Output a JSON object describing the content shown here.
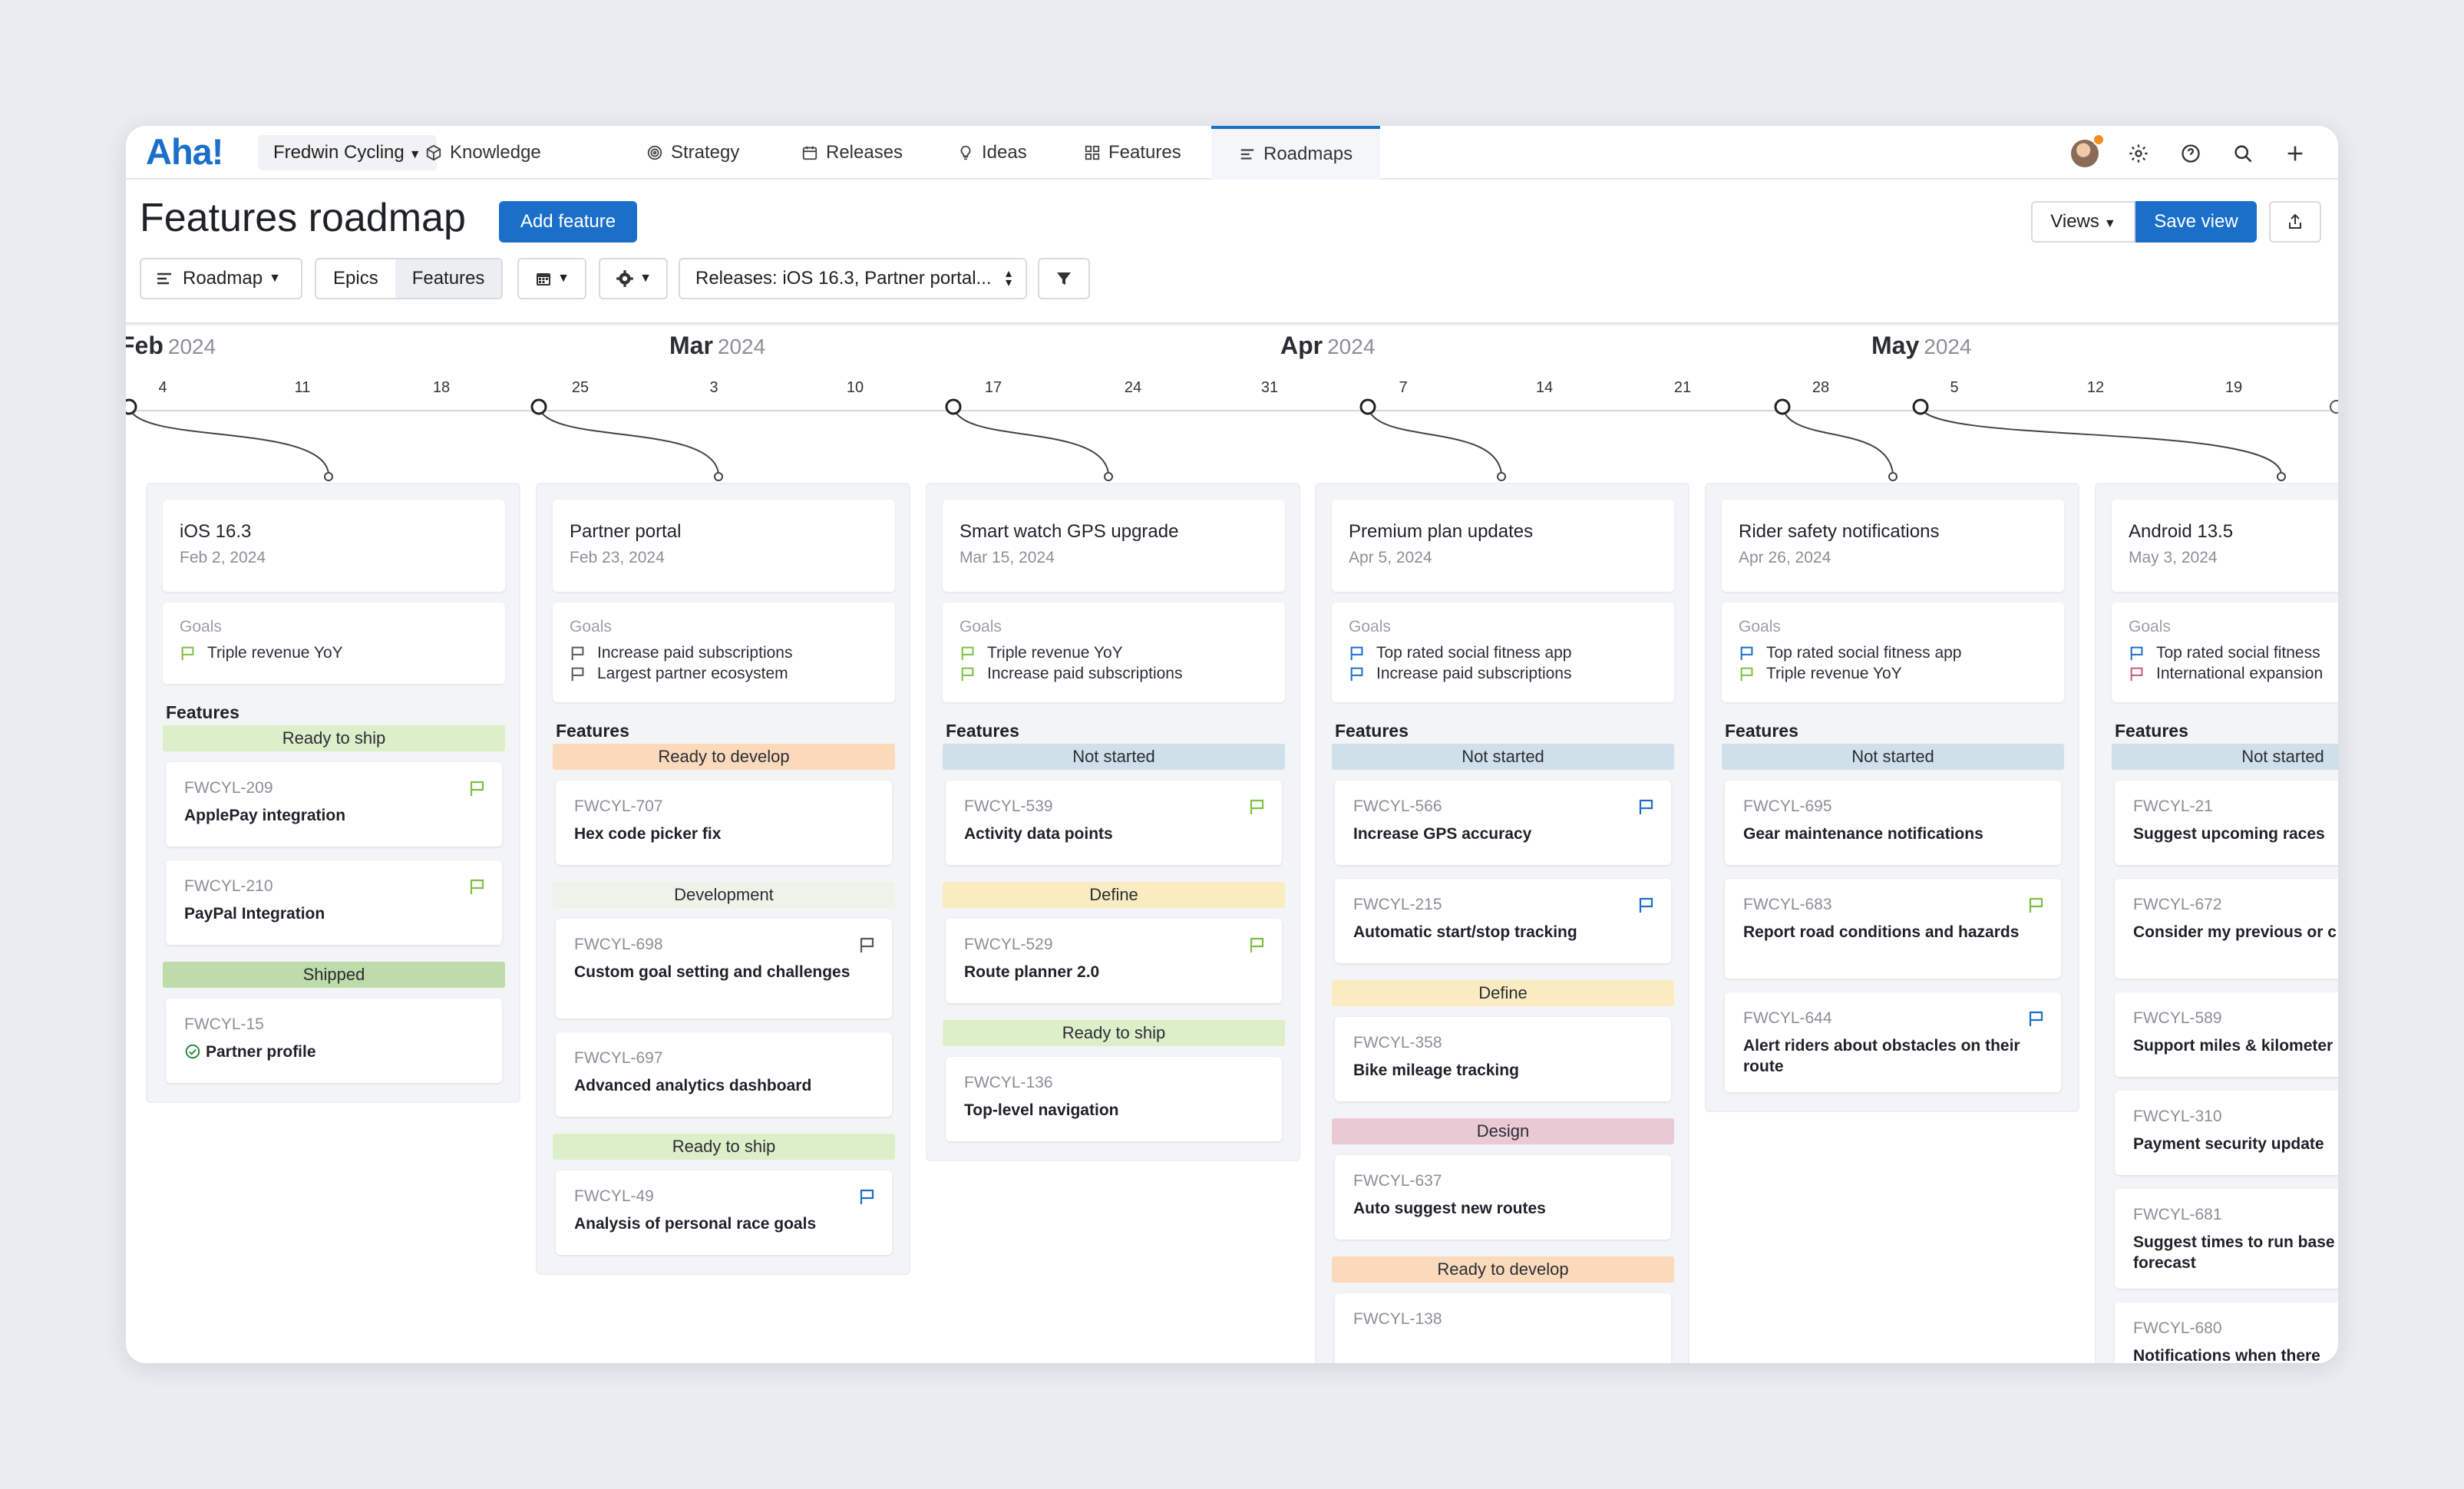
{
  "app": {
    "logo": "Aha!",
    "workspace": "Fredwin Cycling",
    "nav": [
      {
        "label": "Knowledge",
        "icon": "cube-icon"
      },
      {
        "label": "Strategy",
        "icon": "target-icon"
      },
      {
        "label": "Releases",
        "icon": "calendar-icon"
      },
      {
        "label": "Ideas",
        "icon": "lightbulb-icon"
      },
      {
        "label": "Features",
        "icon": "grid-icon"
      },
      {
        "label": "Roadmaps",
        "icon": "roadmap-icon"
      }
    ],
    "active_nav": "Roadmaps"
  },
  "header": {
    "title": "Features roadmap",
    "add_feature": "Add feature",
    "views": "Views",
    "save_view": "Save view"
  },
  "toolbar": {
    "roadmap": "Roadmap",
    "epics": "Epics",
    "features": "Features",
    "releases_filter": "Releases: iOS 16.3, Partner portal..."
  },
  "timeline": {
    "months": [
      {
        "name": "Feb",
        "year": "2024"
      },
      {
        "name": "Mar",
        "year": "2024"
      },
      {
        "name": "Apr",
        "year": "2024"
      },
      {
        "name": "May",
        "year": "2024"
      }
    ],
    "ticks": [
      "4",
      "11",
      "18",
      "25",
      "3",
      "10",
      "17",
      "24",
      "31",
      "7",
      "14",
      "21",
      "28",
      "5",
      "12",
      "19"
    ]
  },
  "colors": {
    "accent": "#1b6fc9",
    "ready_to_ship": "#dcefc9",
    "shipped": "#bedbaa",
    "ready_to_develop": "#fbd9bb",
    "development": "#eef2e8",
    "not_started": "#cfe0ea",
    "define": "#faecc0",
    "design": "#e9c9d3",
    "flag_green": "#7cc043",
    "flag_blue": "#1b6fc9",
    "flag_gray": "#555a60",
    "flag_pink": "#c45a82"
  },
  "goals_label": "Goals",
  "features_label": "Features",
  "releases": [
    {
      "name": "iOS 16.3",
      "date": "Feb 2, 2024",
      "goals": [
        {
          "text": "Triple revenue YoY",
          "color": "green"
        }
      ],
      "groups": [
        {
          "status": "Ready to ship",
          "tone": "ready_to_ship",
          "features": [
            {
              "id": "FWCYL-209",
              "name": "ApplePay integration",
              "flag": "green"
            },
            {
              "id": "FWCYL-210",
              "name": "PayPal Integration",
              "flag": "green"
            }
          ]
        },
        {
          "status": "Shipped",
          "tone": "shipped",
          "features": [
            {
              "id": "FWCYL-15",
              "name": "Partner profile",
              "flag": "",
              "check": true
            }
          ]
        }
      ]
    },
    {
      "name": "Partner portal",
      "date": "Feb 23, 2024",
      "goals": [
        {
          "text": "Increase paid subscriptions",
          "color": "gray"
        },
        {
          "text": "Largest partner ecosystem",
          "color": "gray"
        }
      ],
      "groups": [
        {
          "status": "Ready to develop",
          "tone": "ready_to_develop",
          "features": [
            {
              "id": "FWCYL-707",
              "name": "Hex code picker fix",
              "flag": ""
            }
          ]
        },
        {
          "status": "Development",
          "tone": "development",
          "features": [
            {
              "id": "FWCYL-698",
              "name": "Custom goal setting and challenges",
              "flag": "gray"
            },
            {
              "id": "FWCYL-697",
              "name": "Advanced analytics dashboard",
              "flag": ""
            }
          ]
        },
        {
          "status": "Ready to ship",
          "tone": "ready_to_ship",
          "features": [
            {
              "id": "FWCYL-49",
              "name": "Analysis of personal race goals",
              "flag": "blue"
            }
          ]
        }
      ]
    },
    {
      "name": "Smart watch GPS upgrade",
      "date": "Mar 15, 2024",
      "goals": [
        {
          "text": "Triple revenue YoY",
          "color": "green"
        },
        {
          "text": "Increase paid subscriptions",
          "color": "green"
        }
      ],
      "groups": [
        {
          "status": "Not started",
          "tone": "not_started",
          "features": [
            {
              "id": "FWCYL-539",
              "name": "Activity data points",
              "flag": "green"
            }
          ]
        },
        {
          "status": "Define",
          "tone": "define",
          "features": [
            {
              "id": "FWCYL-529",
              "name": "Route planner 2.0",
              "flag": "green"
            }
          ]
        },
        {
          "status": "Ready to ship",
          "tone": "ready_to_ship",
          "features": [
            {
              "id": "FWCYL-136",
              "name": "Top-level navigation",
              "flag": ""
            }
          ]
        }
      ]
    },
    {
      "name": "Premium plan updates",
      "date": "Apr 5, 2024",
      "goals": [
        {
          "text": "Top rated social fitness app",
          "color": "blue"
        },
        {
          "text": "Increase paid subscriptions",
          "color": "blue"
        }
      ],
      "groups": [
        {
          "status": "Not started",
          "tone": "not_started",
          "features": [
            {
              "id": "FWCYL-566",
              "name": "Increase GPS accuracy",
              "flag": "blue"
            },
            {
              "id": "FWCYL-215",
              "name": "Automatic start/stop tracking",
              "flag": "blue"
            }
          ]
        },
        {
          "status": "Define",
          "tone": "define",
          "features": [
            {
              "id": "FWCYL-358",
              "name": "Bike mileage tracking",
              "flag": ""
            }
          ]
        },
        {
          "status": "Design",
          "tone": "design",
          "features": [
            {
              "id": "FWCYL-637",
              "name": "Auto suggest new routes",
              "flag": ""
            }
          ]
        },
        {
          "status": "Ready to develop",
          "tone": "ready_to_develop",
          "features": [
            {
              "id": "FWCYL-138",
              "name": "",
              "flag": ""
            }
          ]
        }
      ]
    },
    {
      "name": "Rider safety notifications",
      "date": "Apr 26, 2024",
      "goals": [
        {
          "text": "Top rated social fitness app",
          "color": "blue"
        },
        {
          "text": "Triple revenue YoY",
          "color": "green"
        }
      ],
      "groups": [
        {
          "status": "Not started",
          "tone": "not_started",
          "features": [
            {
              "id": "FWCYL-695",
              "name": "Gear maintenance notifications",
              "flag": ""
            },
            {
              "id": "FWCYL-683",
              "name": "Report road conditions and hazards",
              "flag": "green"
            },
            {
              "id": "FWCYL-644",
              "name": "Alert riders about obstacles on their route",
              "flag": "blue"
            }
          ]
        }
      ]
    },
    {
      "name": "Android 13.5",
      "date": "May 3, 2024",
      "goals": [
        {
          "text": "Top rated social fitness",
          "color": "blue"
        },
        {
          "text": "International expansion",
          "color": "pink"
        }
      ],
      "groups": [
        {
          "status": "Not started",
          "tone": "not_started",
          "features": [
            {
              "id": "FWCYL-21",
              "name": "Suggest upcoming races",
              "flag": ""
            },
            {
              "id": "FWCYL-672",
              "name": "Consider my previous or c injuries",
              "flag": ""
            },
            {
              "id": "FWCYL-589",
              "name": "Support miles & kilometer",
              "flag": ""
            },
            {
              "id": "FWCYL-310",
              "name": "Payment security update",
              "flag": ""
            },
            {
              "id": "FWCYL-681",
              "name": "Suggest times to run base weather forecast",
              "flag": ""
            },
            {
              "id": "FWCYL-680",
              "name": "Notifications when there",
              "flag": ""
            }
          ]
        }
      ]
    }
  ]
}
